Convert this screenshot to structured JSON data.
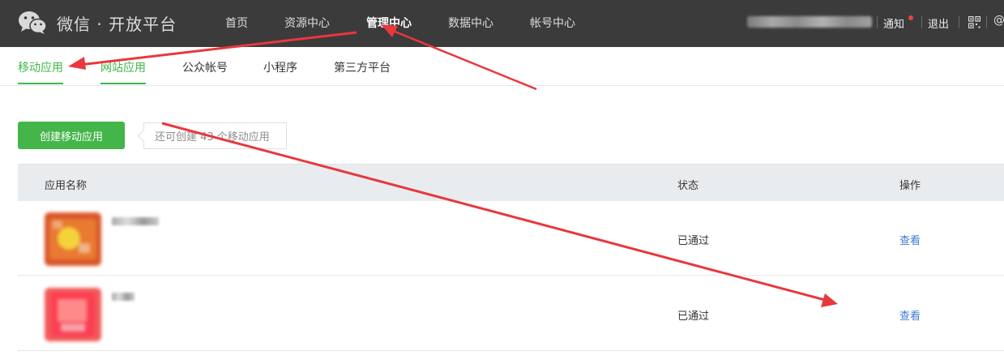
{
  "header": {
    "brand": "微信 · 开放平台",
    "nav": [
      "首页",
      "资源中心",
      "管理中心",
      "数据中心",
      "帐号中心"
    ],
    "active_nav": "管理中心",
    "notify_label": "通知",
    "logout_label": "退出"
  },
  "subnav": {
    "items": [
      "移动应用",
      "网站应用",
      "公众帐号",
      "小程序",
      "第三方平台"
    ],
    "active": "移动应用"
  },
  "create_button": "创建移动应用",
  "create_tip": "还可创建 43 个移动应用",
  "table": {
    "columns": [
      "应用名称",
      "状态",
      "操作"
    ],
    "rows": [
      {
        "status": "已通过",
        "action": "查看"
      },
      {
        "status": "已通过",
        "action": "查看"
      }
    ]
  },
  "colors": {
    "accent_green": "#44b549",
    "link_blue": "#3d7bd2",
    "topbar": "#3b3b3b",
    "annotation_red": "#e8383d"
  }
}
